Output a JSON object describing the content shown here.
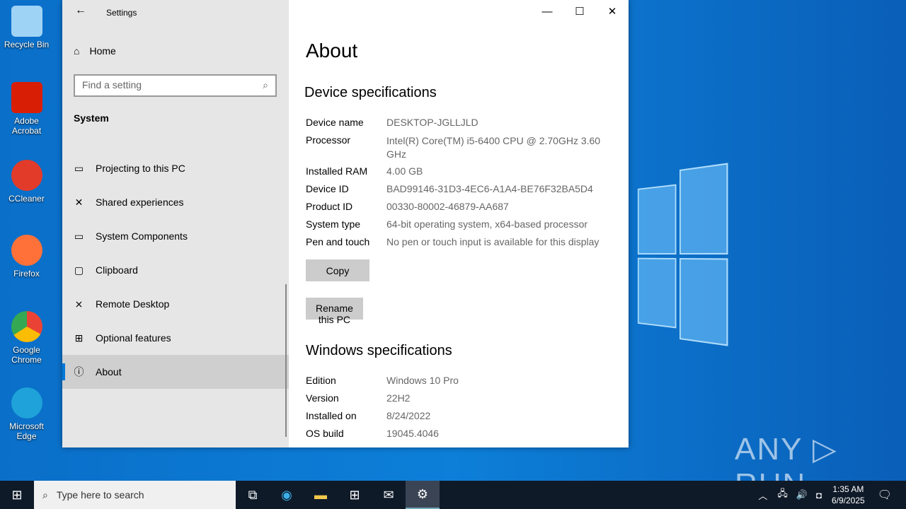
{
  "desktop": {
    "icons": [
      {
        "label": "Recycle Bin",
        "color": "#9fd3f5"
      },
      {
        "label": "Adobe Acrobat",
        "color": "#d81e05"
      },
      {
        "label": "CCleaner",
        "color": "#e23b2a"
      },
      {
        "label": "Firefox",
        "color": "#ff7139"
      },
      {
        "label": "Google Chrome",
        "color": "#34a853"
      },
      {
        "label": "Microsoft Edge",
        "color": "#1fa1d9"
      }
    ],
    "watermark": "ANY ▷ RUN"
  },
  "window": {
    "title": "Settings",
    "controls": {
      "minimize": "—",
      "maximize": "☐",
      "close": "✕"
    }
  },
  "sidebar": {
    "home": "Home",
    "search_placeholder": "Find a setting",
    "section": "System",
    "items": [
      {
        "label": "Projecting to this PC",
        "icon": "▭"
      },
      {
        "label": "Shared experiences",
        "icon": "✕"
      },
      {
        "label": "System Components",
        "icon": "▭"
      },
      {
        "label": "Clipboard",
        "icon": "▢"
      },
      {
        "label": "Remote Desktop",
        "icon": "⨯"
      },
      {
        "label": "Optional features",
        "icon": "⊞"
      },
      {
        "label": "About",
        "icon": "ⓘ"
      }
    ]
  },
  "main": {
    "title": "About",
    "device_heading": "Device specifications",
    "device": [
      {
        "k": "Device name",
        "v": "DESKTOP-JGLLJLD"
      },
      {
        "k": "Processor",
        "v": "Intel(R) Core(TM) i5-6400 CPU @ 2.70GHz   3.60 GHz"
      },
      {
        "k": "Installed RAM",
        "v": "4.00 GB"
      },
      {
        "k": "Device ID",
        "v": "BAD99146-31D3-4EC6-A1A4-BE76F32BA5D4"
      },
      {
        "k": "Product ID",
        "v": "00330-80002-46879-AA687"
      },
      {
        "k": "System type",
        "v": "64-bit operating system, x64-based processor"
      },
      {
        "k": "Pen and touch",
        "v": "No pen or touch input is available for this display"
      }
    ],
    "copy": "Copy",
    "rename": "Rename this PC",
    "windows_heading": "Windows specifications",
    "windows": [
      {
        "k": "Edition",
        "v": "Windows 10 Pro"
      },
      {
        "k": "Version",
        "v": "22H2"
      },
      {
        "k": "Installed on",
        "v": "8/24/2022"
      },
      {
        "k": "OS build",
        "v": "19045.4046"
      }
    ]
  },
  "taskbar": {
    "search_placeholder": "Type here to search",
    "time": "1:35 AM",
    "date": "6/9/2025"
  }
}
